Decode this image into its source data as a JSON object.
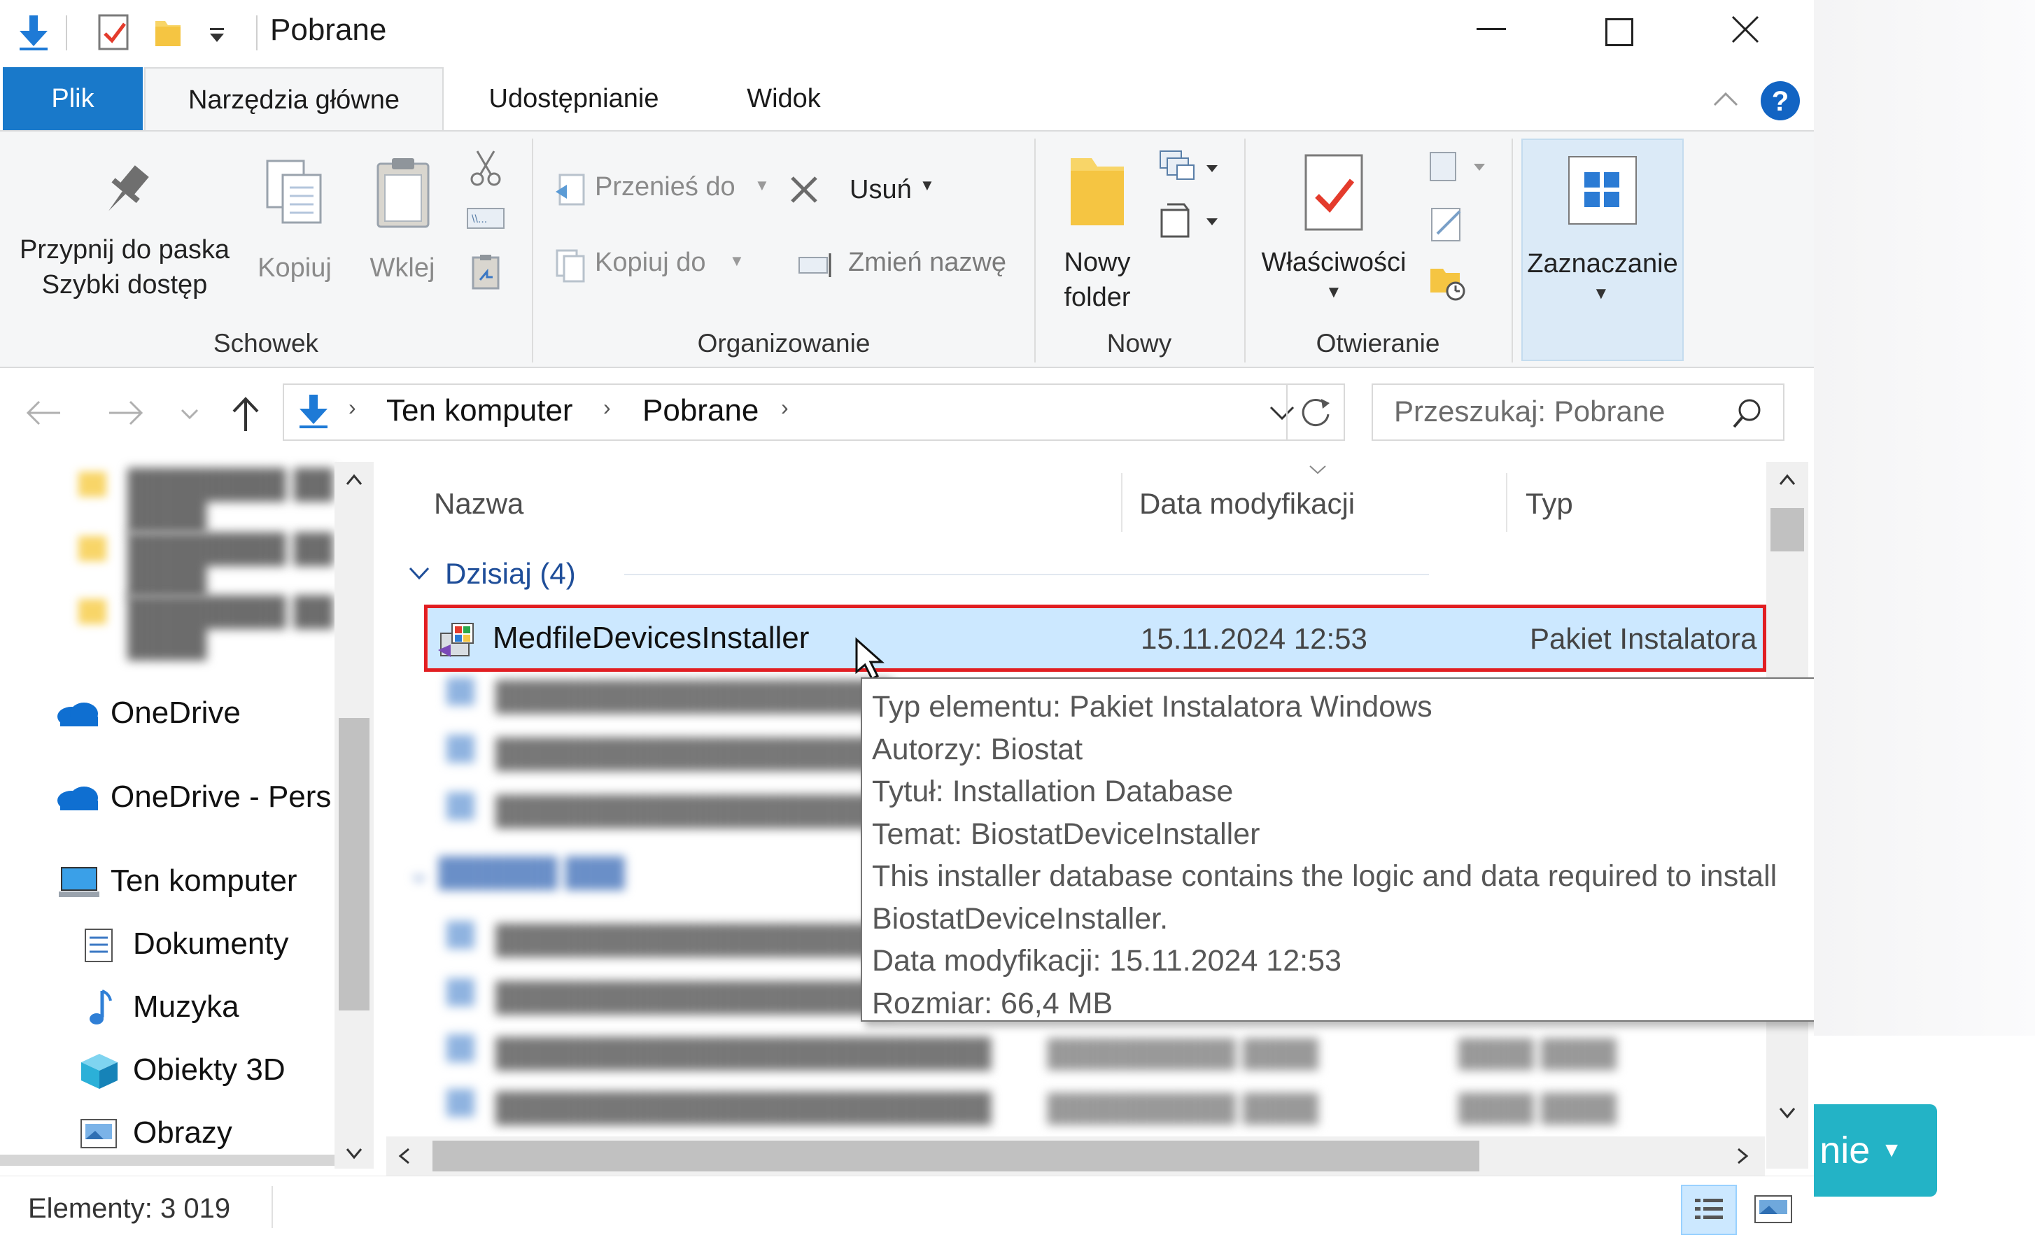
{
  "window": {
    "title": "Pobrane"
  },
  "ribbon_tabs": {
    "file": "Plik",
    "home": "Narzędzia główne",
    "share": "Udostępnianie",
    "view": "Widok"
  },
  "ribbon": {
    "pin": {
      "line1": "Przypnij do paska",
      "line2": "Szybki dostęp"
    },
    "copy": "Kopiuj",
    "paste": "Wklej",
    "move_to": "Przenieś do",
    "copy_to": "Kopiuj do",
    "delete": "Usuń",
    "rename": "Zmień nazwę",
    "new_folder": {
      "line1": "Nowy",
      "line2": "folder"
    },
    "properties": "Właściwości",
    "select": "Zaznaczanie",
    "groups": {
      "clipboard": "Schowek",
      "organize": "Organizowanie",
      "new": "Nowy",
      "open": "Otwieranie"
    }
  },
  "address": {
    "crumbs": [
      "Ten komputer",
      "Pobrane"
    ],
    "search_placeholder": "Przeszukaj: Pobrane"
  },
  "nav_pane": {
    "items": [
      "OneDrive",
      "OneDrive - Pers",
      "Ten komputer",
      "Dokumenty",
      "Muzyka",
      "Obiekty 3D",
      "Obrazy"
    ]
  },
  "file_list": {
    "columns": [
      "Nazwa",
      "Data modyfikacji",
      "Typ"
    ],
    "group_today": "Dzisiaj (4)",
    "selected_row": {
      "name": "MedfileDevicesInstaller",
      "date": "15.11.2024 12:53",
      "type": "Pakiet Instalatora"
    }
  },
  "tooltip": {
    "lines": [
      "Typ elementu: Pakiet Instalatora Windows",
      "Autorzy: Biostat",
      "Tytuł: Installation Database",
      "Temat: BiostatDeviceInstaller",
      "This installer database contains the logic and data required to install",
      "BiostatDeviceInstaller.",
      "Data modyfikacji: 15.11.2024 12:53",
      "Rozmiar: 66,4 MB"
    ]
  },
  "status": {
    "items": "Elementy: 3 019"
  },
  "background_button": {
    "label": "nie"
  },
  "colors": {
    "accent": "#1979ca",
    "selection": "#cce8ff",
    "highlight_border": "#e11e22",
    "background_button": "#23b3c6"
  }
}
